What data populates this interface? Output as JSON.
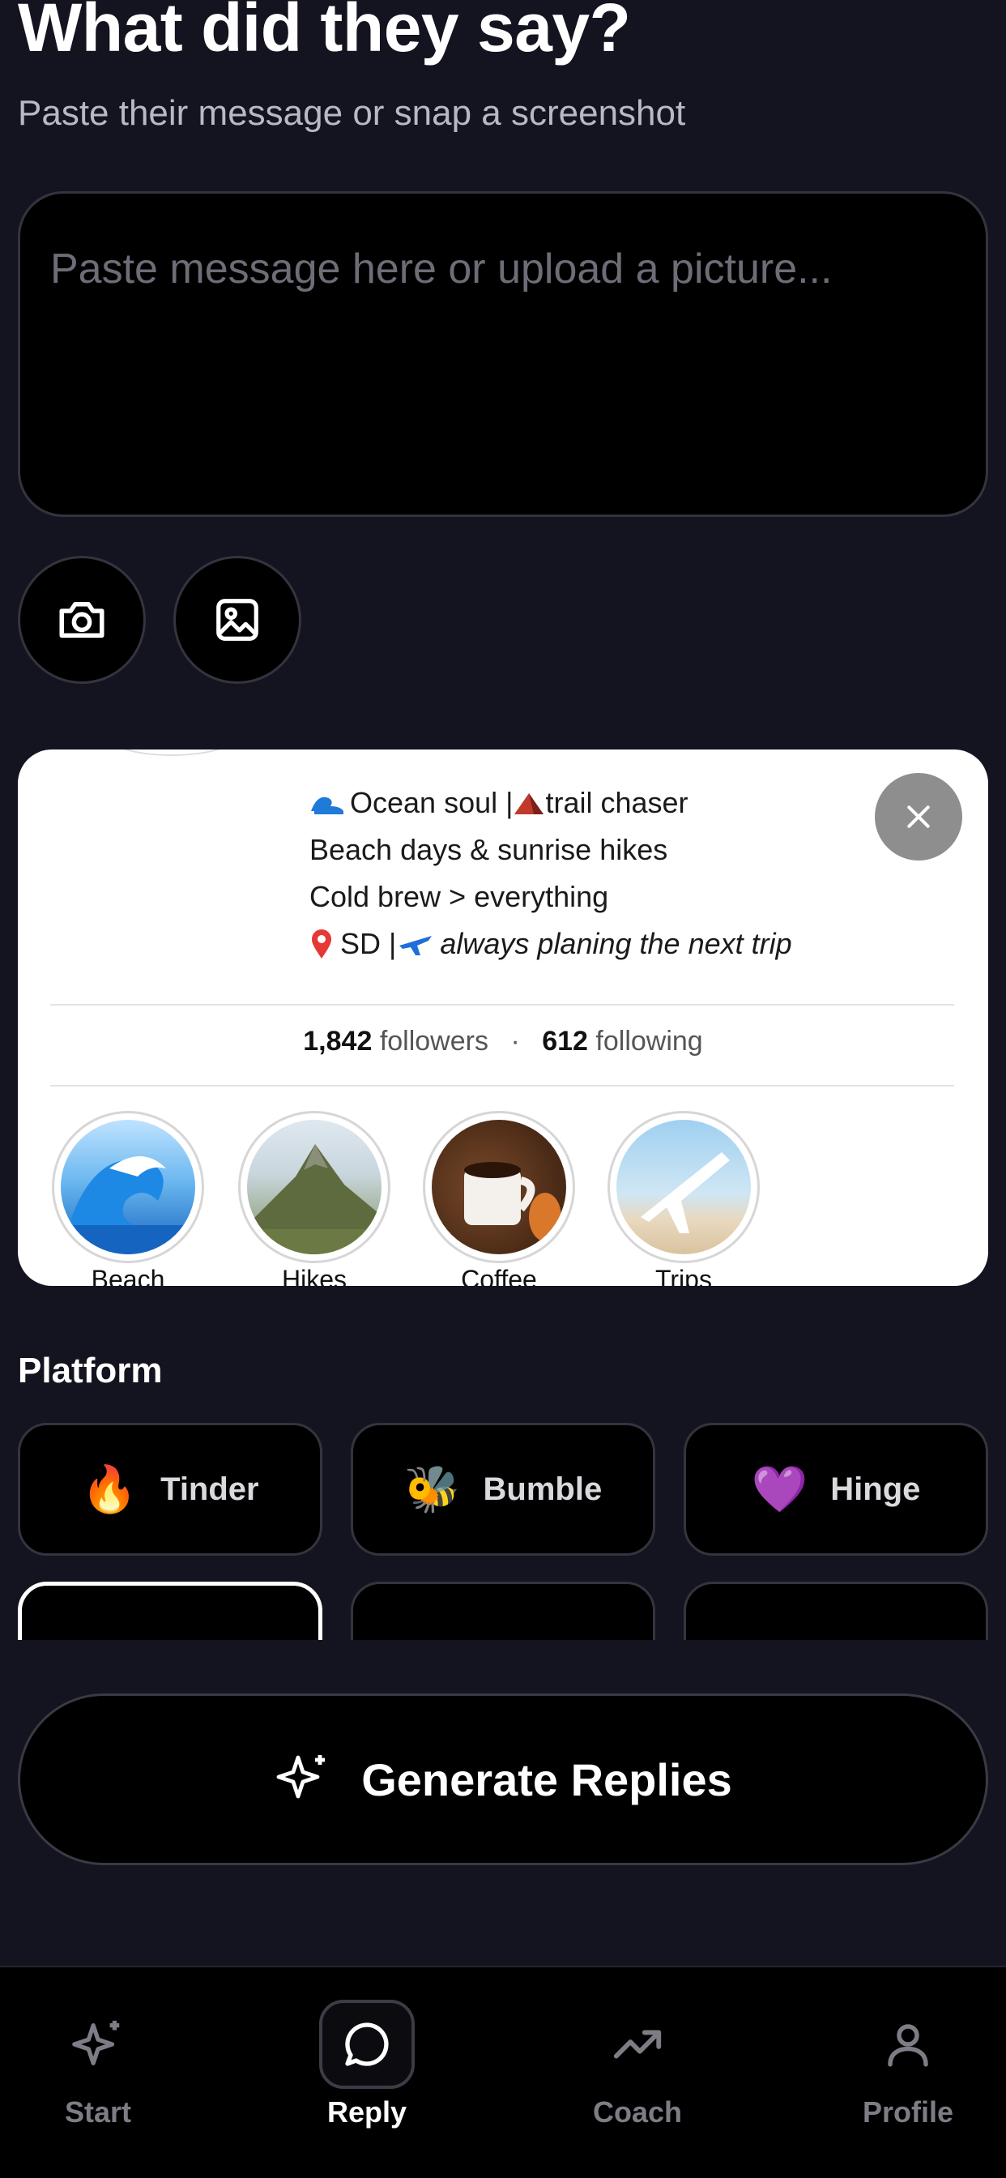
{
  "header": {
    "title": "What did they say?",
    "subtitle": "Paste their message or snap a screenshot"
  },
  "message_input": {
    "placeholder": "Paste message here or upload a picture..."
  },
  "buttons": {
    "camera_icon": "camera-icon",
    "gallery_icon": "image-icon"
  },
  "preview": {
    "bio": {
      "line1": "Ocean soul | ",
      "line1b": "trail chaser",
      "line2": "Beach days & sunrise hikes",
      "line3": "Cold brew > everything",
      "line4a": "SD | ",
      "line4b": "always planing the next trip"
    },
    "stats": {
      "followers_count": "1,842",
      "followers_label": "followers",
      "separator": "·",
      "following_count": "612",
      "following_label": "following"
    },
    "highlights": [
      {
        "label": "Beach"
      },
      {
        "label": "Hikes"
      },
      {
        "label": "Coffee"
      },
      {
        "label": "Trips"
      }
    ]
  },
  "platform": {
    "title": "Platform",
    "options": [
      {
        "label": "Tinder",
        "emoji": "🔥"
      },
      {
        "label": "Bumble",
        "emoji": "🐝"
      },
      {
        "label": "Hinge",
        "emoji": "💜"
      }
    ]
  },
  "generate": {
    "label": "Generate Replies"
  },
  "tabs": [
    {
      "label": "Start"
    },
    {
      "label": "Reply"
    },
    {
      "label": "Coach"
    },
    {
      "label": "Profile"
    }
  ],
  "colors": {
    "background": "#141420",
    "surface": "#000000",
    "border": "#34343e",
    "text": "#ffffff",
    "muted": "#7d7d86"
  }
}
